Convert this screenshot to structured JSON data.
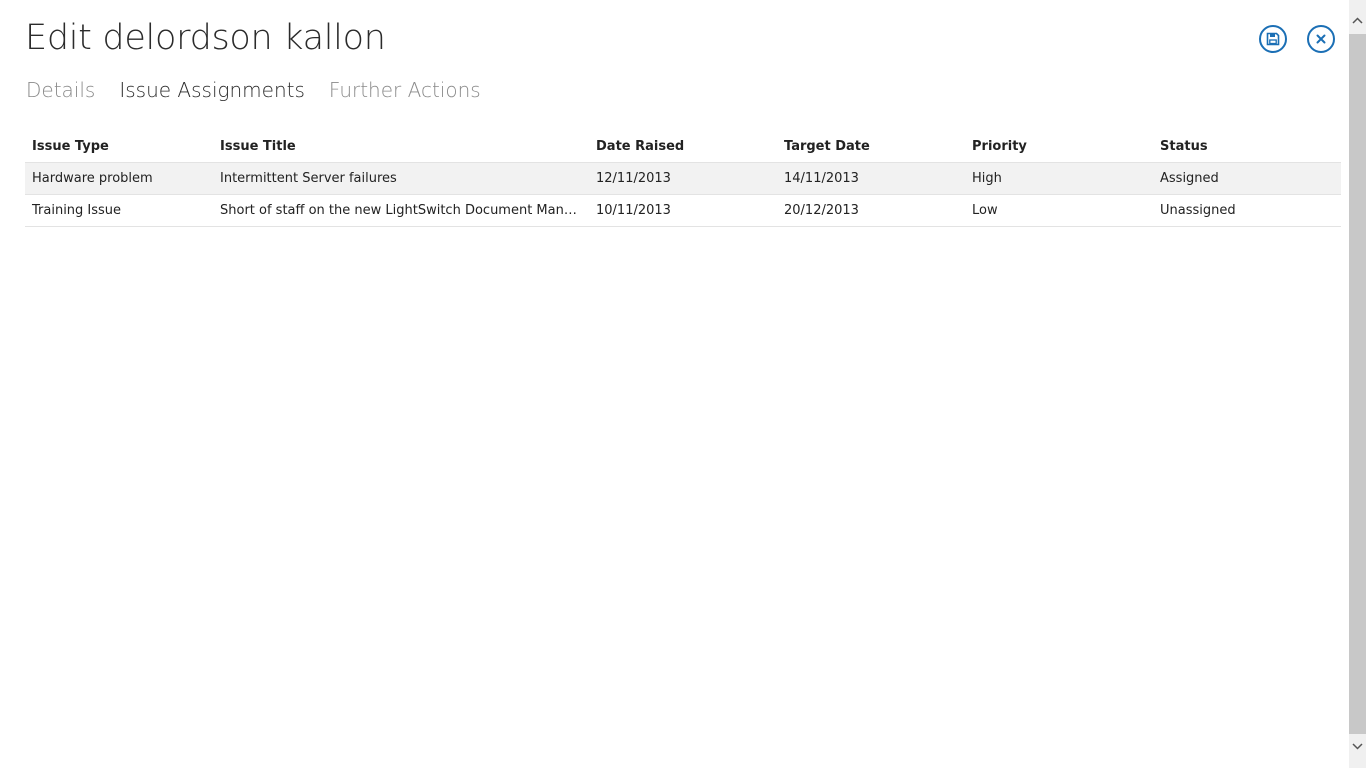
{
  "page": {
    "title": "Edit delordson kallon",
    "save_icon": "save-icon",
    "close_icon": "close-icon",
    "accent_color": "#1b6fb5"
  },
  "tabs": [
    {
      "label": "Details",
      "active": false
    },
    {
      "label": "Issue Assignments",
      "active": true
    },
    {
      "label": "Further Actions",
      "active": false
    }
  ],
  "table": {
    "columns": [
      "Issue Type",
      "Issue Title",
      "Date Raised",
      "Target Date",
      "Priority",
      "Status"
    ],
    "rows": [
      [
        "Hardware problem",
        "Intermittent Server failures",
        "12/11/2013",
        "14/11/2013",
        "High",
        "Assigned"
      ],
      [
        "Training Issue",
        "Short of staff on the new LightSwitch Document Management System",
        "10/11/2013",
        "20/12/2013",
        "Low",
        "Unassigned"
      ]
    ]
  }
}
